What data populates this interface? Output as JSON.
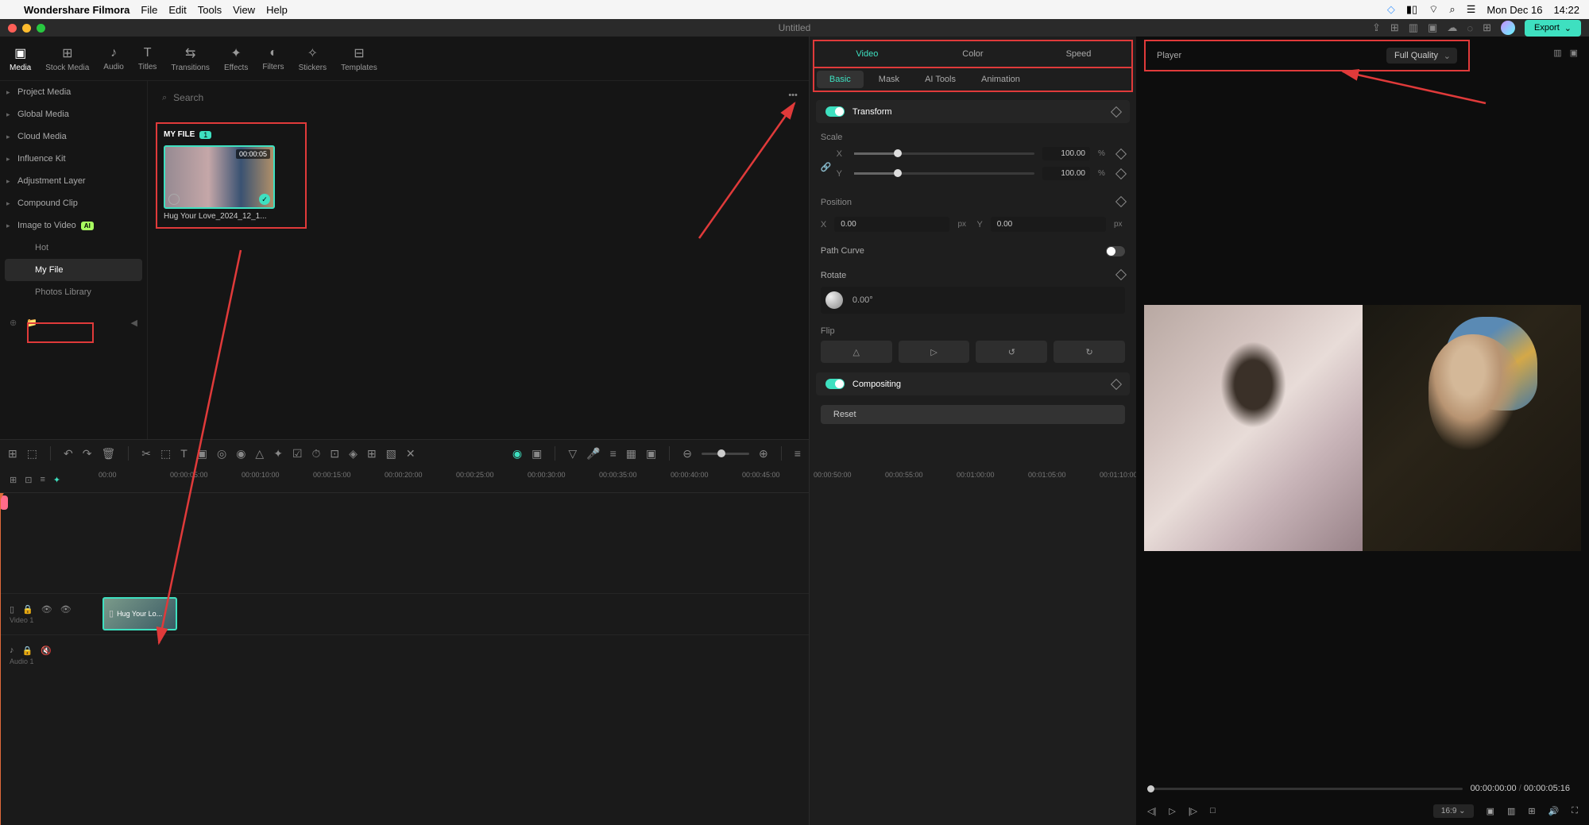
{
  "menubar": {
    "app": "Wondershare Filmora",
    "items": [
      "File",
      "Edit",
      "Tools",
      "View",
      "Help"
    ],
    "date": "Mon Dec 16",
    "time": "14:22"
  },
  "window": {
    "title": "Untitled"
  },
  "export": {
    "label": "Export"
  },
  "toolbar": [
    {
      "icon": "▣",
      "label": "Media",
      "active": true
    },
    {
      "icon": "⊞",
      "label": "Stock Media"
    },
    {
      "icon": "♪",
      "label": "Audio"
    },
    {
      "icon": "T",
      "label": "Titles"
    },
    {
      "icon": "⇆",
      "label": "Transitions"
    },
    {
      "icon": "✦",
      "label": "Effects"
    },
    {
      "icon": "◐",
      "label": "Filters"
    },
    {
      "icon": "✧",
      "label": "Stickers"
    },
    {
      "icon": "⊟",
      "label": "Templates"
    }
  ],
  "sidebar": {
    "items": [
      {
        "label": "Project Media"
      },
      {
        "label": "Global Media"
      },
      {
        "label": "Cloud Media"
      },
      {
        "label": "Influence Kit"
      },
      {
        "label": "Adjustment Layer"
      },
      {
        "label": "Compound Clip"
      },
      {
        "label": "Image to Video",
        "badge": "AI",
        "subs": [
          {
            "label": "Hot"
          },
          {
            "label": "My File",
            "active": true
          },
          {
            "label": "Photos Library"
          }
        ]
      }
    ]
  },
  "search": {
    "placeholder": "Search"
  },
  "folder": {
    "name": "MY FILE",
    "count": "1",
    "thumb_name": "Hug Your Love_2024_12_1...",
    "duration": "00:00:05"
  },
  "inspector": {
    "tabs": [
      "Video",
      "Color",
      "Speed"
    ],
    "subtabs": [
      "Basic",
      "Mask",
      "AI Tools",
      "Animation"
    ],
    "transform": "Transform",
    "scale_label": "Scale",
    "scale_x": "100.00",
    "scale_y": "100.00",
    "scale_unit": "%",
    "position_label": "Position",
    "pos_x": "0.00",
    "pos_y": "0.00",
    "pos_unit": "px",
    "path_curve": "Path Curve",
    "rotate_label": "Rotate",
    "rotate_val": "0.00°",
    "flip_label": "Flip",
    "compositing": "Compositing",
    "reset": "Reset"
  },
  "preview": {
    "player_label": "Player",
    "quality": "Full Quality",
    "time_current": "00:00:00:00",
    "time_total": "00:00:05:16",
    "aspect": "16:9"
  },
  "timeline": {
    "ticks": [
      "00:00",
      "00:00:05:00",
      "00:00:10:00",
      "00:00:15:00",
      "00:00:20:00",
      "00:00:25:00",
      "00:00:30:00",
      "00:00:35:00",
      "00:00:40:00",
      "00:00:45:00",
      "00:00:50:00",
      "00:00:55:00",
      "00:01:00:00",
      "00:01:05:00",
      "00:01:10:00"
    ],
    "video_track": "Video 1",
    "audio_track": "Audio 1",
    "clip_name": "Hug Your Lo..."
  }
}
